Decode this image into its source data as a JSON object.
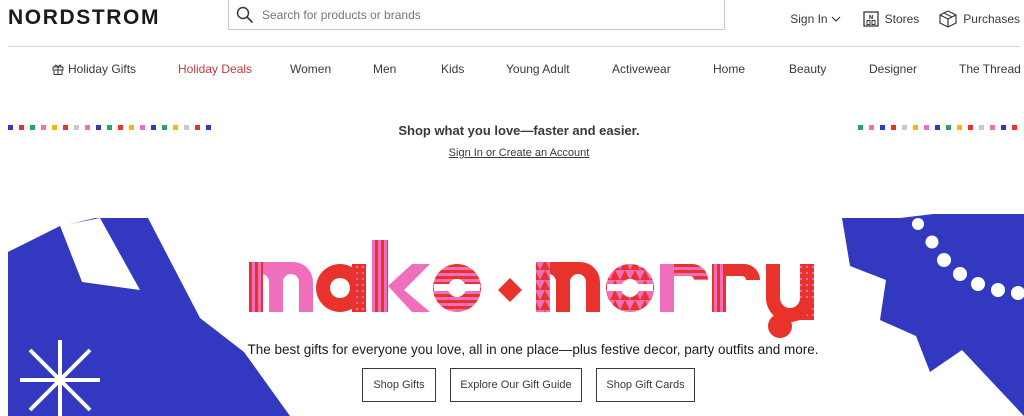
{
  "header": {
    "logo": "NORDSTROM",
    "search_placeholder": "Search for products or brands",
    "sign_in": "Sign In",
    "stores": "Stores",
    "purchases": "Purchases"
  },
  "nav": {
    "items": [
      "Holiday Gifts",
      "Holiday Deals",
      "Women",
      "Men",
      "Kids",
      "Young Adult",
      "Activewear",
      "Home",
      "Beauty",
      "Designer",
      "The Thread"
    ]
  },
  "banner": {
    "title": "Shop what you love—faster and easier.",
    "link": "Sign In or Create an Account"
  },
  "hero": {
    "headline": "make · merry",
    "subtext": "The best gifts for everyone you love, all in one place—plus festive decor, party outfits and more.",
    "buttons": [
      "Shop Gifts",
      "Explore Our Gift Guide",
      "Shop Gift Cards"
    ]
  },
  "colors": {
    "accent_red": "#c03a3a",
    "hero_blue": "#3238c0",
    "hero_pink": "#ef6fbd",
    "hero_red": "#e8332c"
  }
}
